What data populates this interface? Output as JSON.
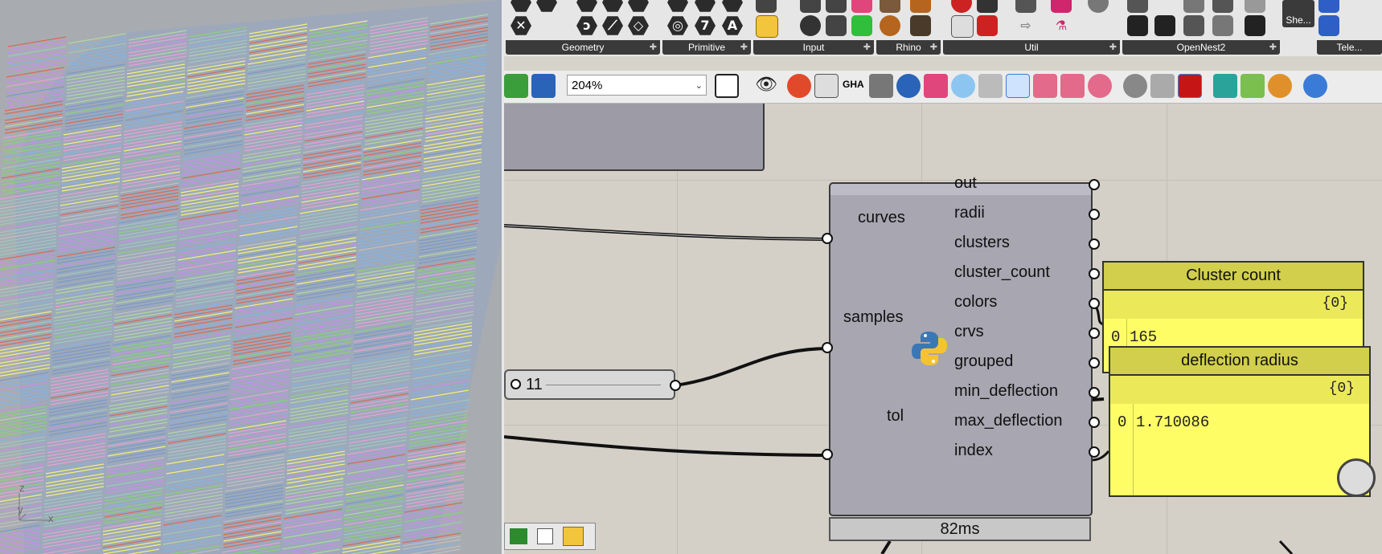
{
  "viewport": {
    "axis_z": "z",
    "axis_y": "y",
    "axis_x": "x"
  },
  "ribbon": {
    "groups": [
      {
        "label": "Geometry"
      },
      {
        "label": "Primitive"
      },
      {
        "label": "Input"
      },
      {
        "label": "Rhino"
      },
      {
        "label": "Util"
      },
      {
        "label": "OpenNest2"
      },
      {
        "label": "She..."
      },
      {
        "label": "Tele..."
      }
    ]
  },
  "toolbar": {
    "zoom_value": "204%"
  },
  "python_component": {
    "inputs": [
      "curves",
      "samples",
      "tol"
    ],
    "outputs": [
      "out",
      "radii",
      "clusters",
      "cluster_count",
      "colors",
      "crvs",
      "grouped",
      "min_deflection",
      "max_deflection",
      "index"
    ],
    "timing": "82ms"
  },
  "slider": {
    "value": "11"
  },
  "panels": [
    {
      "title": "Cluster count",
      "path": "{0}",
      "index": "0",
      "value": "165"
    },
    {
      "title": "deflection radius",
      "path": "{0}",
      "index": "0",
      "value": "1.710086"
    }
  ],
  "colors": {
    "panel_yellow": "#fffd66",
    "panel_title": "#d1cf4b",
    "component": "#a7a6b1",
    "canvas": "#d4d0c8"
  }
}
